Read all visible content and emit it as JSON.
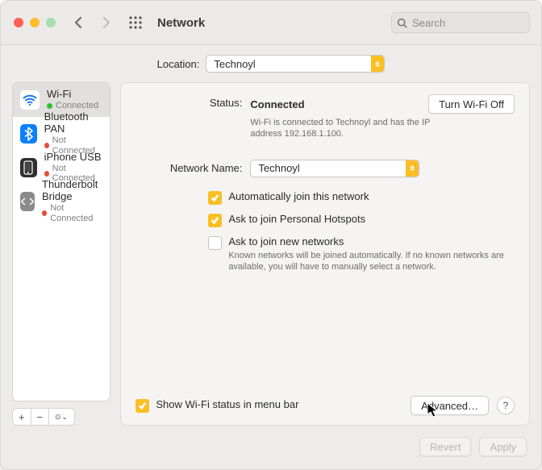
{
  "toolbar": {
    "title": "Network",
    "search_placeholder": "Search"
  },
  "location": {
    "label": "Location:",
    "value": "Technoyl"
  },
  "sidebar": {
    "services": [
      {
        "name": "Wi-Fi",
        "status": "Connected",
        "connected": true
      },
      {
        "name": "Bluetooth PAN",
        "status": "Not Connected",
        "connected": false
      },
      {
        "name": "iPhone USB",
        "status": "Not Connected",
        "connected": false
      },
      {
        "name": "Thunderbolt Bridge",
        "status": "Not Connected",
        "connected": false
      }
    ],
    "selected_index": 0,
    "add_label": "+",
    "remove_label": "−",
    "more_label": "⊙⌄"
  },
  "main": {
    "status_label": "Status:",
    "status_value": "Connected",
    "wifi_toggle_label": "Turn Wi-Fi Off",
    "status_detail": "Wi-Fi is connected to Technoyl and has the IP address 192.168.1.100.",
    "network_name_label": "Network Name:",
    "network_name_value": "Technoyl",
    "auto_join_label": "Automatically join this network",
    "auto_join_checked": true,
    "ask_hotspot_label": "Ask to join Personal Hotspots",
    "ask_hotspot_checked": true,
    "ask_new_label": "Ask to join new networks",
    "ask_new_checked": false,
    "ask_new_help": "Known networks will be joined automatically. If no known networks are available, you will have to manually select a network.",
    "show_status_label": "Show Wi-Fi status in menu bar",
    "show_status_checked": true,
    "advanced_label": "Advanced…",
    "help_label": "?"
  },
  "footer": {
    "revert_label": "Revert",
    "apply_label": "Apply"
  }
}
